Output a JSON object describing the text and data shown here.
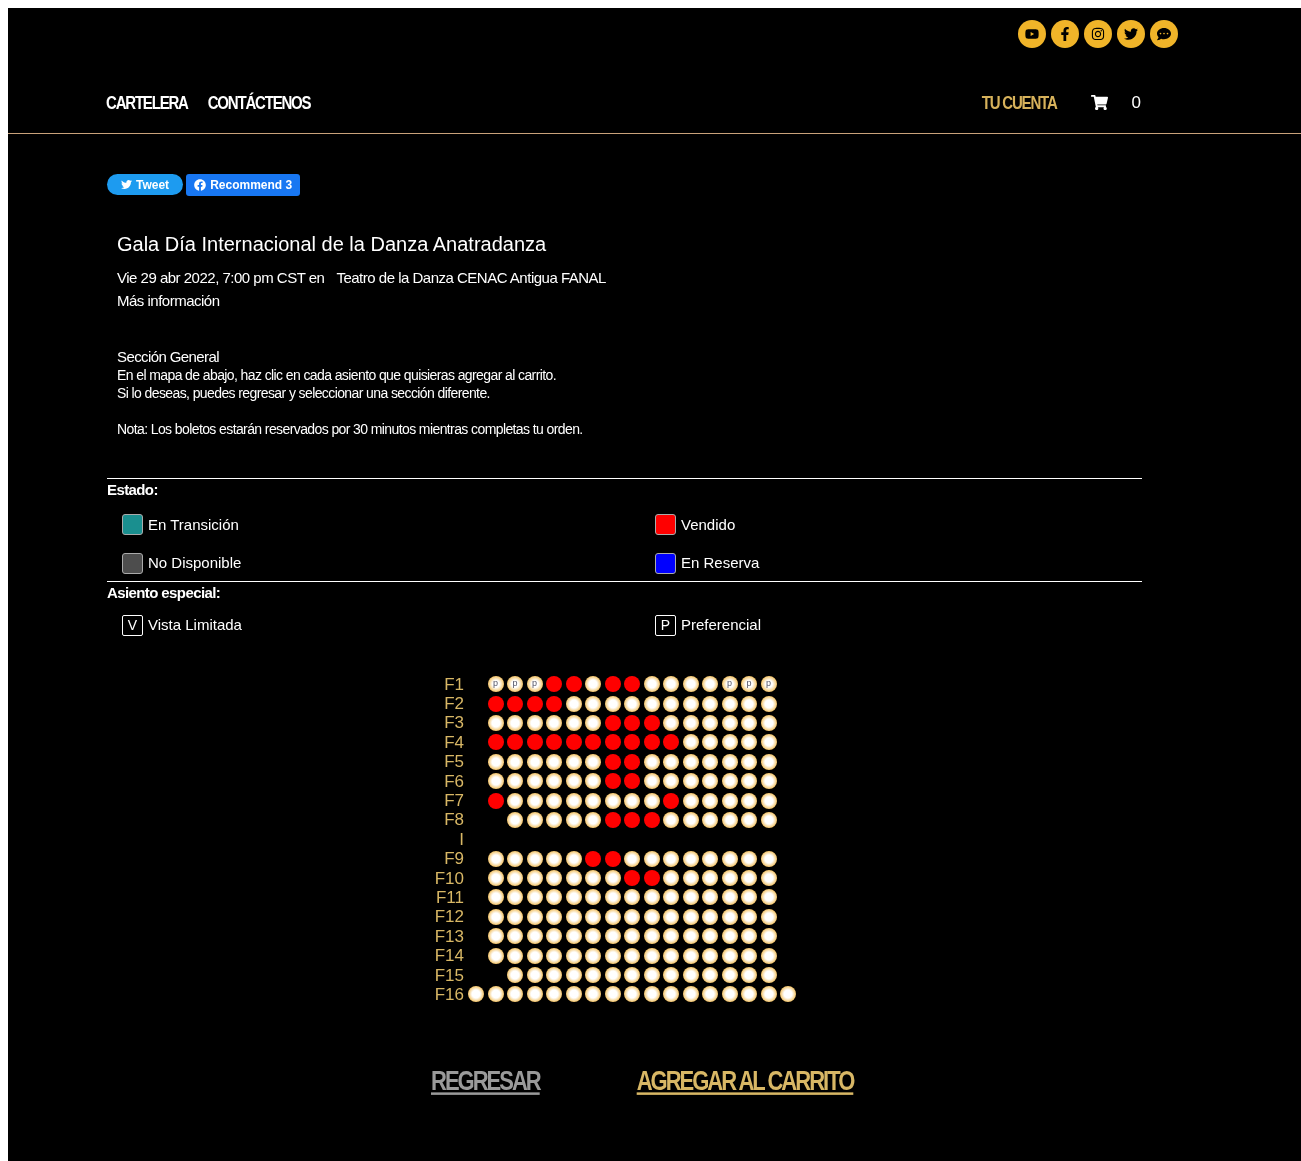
{
  "header": {
    "nav": [
      {
        "label": "CARTELERA"
      },
      {
        "label": "CONTÁCTENOS"
      }
    ],
    "account": "TU CUENTA",
    "cart_count": "0"
  },
  "share": {
    "tweet": "Tweet",
    "recommend": "Recommend 3"
  },
  "event": {
    "title": "Gala Día Internacional de la Danza Anatradanza",
    "date": "Vie 29 abr 2022, 7:00 pm CST en",
    "venue": "Teatro de la Danza CENAC Antigua FANAL",
    "more": "Más información"
  },
  "instructions": [
    "Sección General",
    "En el mapa de abajo, haz clic en cada asiento que quisieras agregar al carrito.",
    "Si lo deseas, puedes regresar y seleccionar una sección diferente."
  ],
  "note": "Nota: Los boletos estarán reservados por 30 minutos mientras completas tu orden.",
  "status_legend": {
    "title": "Estado:",
    "items": [
      {
        "label": "En Transición",
        "color": "#1a8f8f"
      },
      {
        "label": "Vendido",
        "color": "#ff0000"
      },
      {
        "label": "No Disponible",
        "color": "#4d4d4d"
      },
      {
        "label": "En Reserva",
        "color": "#0000ff"
      }
    ]
  },
  "special_legend": {
    "title": "Asiento especial:",
    "items": [
      {
        "mark": "V",
        "label": "Vista Limitada"
      },
      {
        "mark": "P",
        "label": "Preferencial"
      }
    ]
  },
  "seat_map": {
    "rows": [
      {
        "label": "F1",
        "seats": [
          {
            "sold": false,
            "mark": "p"
          },
          {
            "sold": false,
            "mark": "p"
          },
          {
            "sold": false,
            "mark": "p"
          },
          {
            "sold": true
          },
          {
            "sold": true
          },
          {
            "sold": false
          },
          {
            "sold": true
          },
          {
            "sold": true
          },
          {
            "sold": false
          },
          {
            "sold": false
          },
          {
            "sold": false
          },
          {
            "sold": false
          },
          {
            "sold": false,
            "mark": "p"
          },
          {
            "sold": false,
            "mark": "p"
          },
          {
            "sold": false,
            "mark": "p"
          }
        ]
      },
      {
        "label": "F2",
        "seats": [
          {
            "sold": true
          },
          {
            "sold": true
          },
          {
            "sold": true
          },
          {
            "sold": true
          },
          {
            "sold": false
          },
          {
            "sold": false
          },
          {
            "sold": false
          },
          {
            "sold": false
          },
          {
            "sold": false
          },
          {
            "sold": false
          },
          {
            "sold": false
          },
          {
            "sold": false
          },
          {
            "sold": false
          },
          {
            "sold": false
          },
          {
            "sold": false
          }
        ]
      },
      {
        "label": "F3",
        "seats": [
          {
            "sold": false
          },
          {
            "sold": false
          },
          {
            "sold": false
          },
          {
            "sold": false
          },
          {
            "sold": false
          },
          {
            "sold": false
          },
          {
            "sold": true
          },
          {
            "sold": true
          },
          {
            "sold": true
          },
          {
            "sold": false
          },
          {
            "sold": false
          },
          {
            "sold": false
          },
          {
            "sold": false
          },
          {
            "sold": false
          },
          {
            "sold": false
          }
        ]
      },
      {
        "label": "F4",
        "seats": [
          {
            "sold": true
          },
          {
            "sold": true
          },
          {
            "sold": true
          },
          {
            "sold": true
          },
          {
            "sold": true
          },
          {
            "sold": true
          },
          {
            "sold": true
          },
          {
            "sold": true
          },
          {
            "sold": true
          },
          {
            "sold": true
          },
          {
            "sold": false
          },
          {
            "sold": false
          },
          {
            "sold": false
          },
          {
            "sold": false
          },
          {
            "sold": false
          }
        ]
      },
      {
        "label": "F5",
        "seats": [
          {
            "sold": false
          },
          {
            "sold": false
          },
          {
            "sold": false
          },
          {
            "sold": false
          },
          {
            "sold": false
          },
          {
            "sold": false
          },
          {
            "sold": true
          },
          {
            "sold": true
          },
          {
            "sold": false
          },
          {
            "sold": false
          },
          {
            "sold": false
          },
          {
            "sold": false
          },
          {
            "sold": false
          },
          {
            "sold": false
          },
          {
            "sold": false
          }
        ]
      },
      {
        "label": "F6",
        "seats": [
          {
            "sold": false
          },
          {
            "sold": false
          },
          {
            "sold": false
          },
          {
            "sold": false
          },
          {
            "sold": false
          },
          {
            "sold": false
          },
          {
            "sold": true
          },
          {
            "sold": true
          },
          {
            "sold": false
          },
          {
            "sold": false
          },
          {
            "sold": false
          },
          {
            "sold": false
          },
          {
            "sold": false
          },
          {
            "sold": false
          },
          {
            "sold": false
          }
        ]
      },
      {
        "label": "F7",
        "seats": [
          {
            "sold": true
          },
          {
            "sold": false
          },
          {
            "sold": false
          },
          {
            "sold": false
          },
          {
            "sold": false
          },
          {
            "sold": false
          },
          {
            "sold": false
          },
          {
            "sold": false
          },
          {
            "sold": false
          },
          {
            "sold": true
          },
          {
            "sold": false
          },
          {
            "sold": false
          },
          {
            "sold": false
          },
          {
            "sold": false
          },
          {
            "sold": false
          }
        ]
      },
      {
        "label": "F8",
        "seats": [
          {
            "sold": false
          },
          {
            "sold": false
          },
          {
            "sold": false
          },
          {
            "sold": false
          },
          {
            "sold": false
          },
          {
            "sold": true
          },
          {
            "sold": true
          },
          {
            "sold": true
          },
          {
            "sold": false
          },
          {
            "sold": false
          },
          {
            "sold": false
          },
          {
            "sold": false
          },
          {
            "sold": false
          },
          {
            "sold": false
          }
        ]
      },
      {
        "label": "I"
      },
      {
        "label": "F9",
        "seats": [
          {
            "sold": false
          },
          {
            "sold": false
          },
          {
            "sold": false
          },
          {
            "sold": false
          },
          {
            "sold": false
          },
          {
            "sold": true
          },
          {
            "sold": true
          },
          {
            "sold": false
          },
          {
            "sold": false
          },
          {
            "sold": false
          },
          {
            "sold": false
          },
          {
            "sold": false
          },
          {
            "sold": false
          },
          {
            "sold": false
          },
          {
            "sold": false
          }
        ]
      },
      {
        "label": "F10",
        "seats": [
          {
            "sold": false
          },
          {
            "sold": false
          },
          {
            "sold": false
          },
          {
            "sold": false
          },
          {
            "sold": false
          },
          {
            "sold": false
          },
          {
            "sold": false
          },
          {
            "sold": true
          },
          {
            "sold": true
          },
          {
            "sold": false
          },
          {
            "sold": false
          },
          {
            "sold": false
          },
          {
            "sold": false
          },
          {
            "sold": false
          },
          {
            "sold": false
          }
        ]
      },
      {
        "label": "F11",
        "seats": [
          {
            "sold": false
          },
          {
            "sold": false
          },
          {
            "sold": false
          },
          {
            "sold": false
          },
          {
            "sold": false
          },
          {
            "sold": false
          },
          {
            "sold": false
          },
          {
            "sold": false
          },
          {
            "sold": false
          },
          {
            "sold": false
          },
          {
            "sold": false
          },
          {
            "sold": false
          },
          {
            "sold": false
          },
          {
            "sold": false
          },
          {
            "sold": false
          }
        ]
      },
      {
        "label": "F12",
        "seats": [
          {
            "sold": false
          },
          {
            "sold": false
          },
          {
            "sold": false
          },
          {
            "sold": false
          },
          {
            "sold": false
          },
          {
            "sold": false
          },
          {
            "sold": false
          },
          {
            "sold": false
          },
          {
            "sold": false
          },
          {
            "sold": false
          },
          {
            "sold": false
          },
          {
            "sold": false
          },
          {
            "sold": false
          },
          {
            "sold": false
          },
          {
            "sold": false
          }
        ]
      },
      {
        "label": "F13",
        "seats": [
          {
            "sold": false
          },
          {
            "sold": false
          },
          {
            "sold": false
          },
          {
            "sold": false
          },
          {
            "sold": false
          },
          {
            "sold": false
          },
          {
            "sold": false
          },
          {
            "sold": false
          },
          {
            "sold": false
          },
          {
            "sold": false
          },
          {
            "sold": false
          },
          {
            "sold": false
          },
          {
            "sold": false
          },
          {
            "sold": false
          },
          {
            "sold": false
          }
        ]
      },
      {
        "label": "F14",
        "seats": [
          {
            "sold": false
          },
          {
            "sold": false
          },
          {
            "sold": false
          },
          {
            "sold": false
          },
          {
            "sold": false
          },
          {
            "sold": false
          },
          {
            "sold": false
          },
          {
            "sold": false
          },
          {
            "sold": false
          },
          {
            "sold": false
          },
          {
            "sold": false
          },
          {
            "sold": false
          },
          {
            "sold": false
          },
          {
            "sold": false
          },
          {
            "sold": false
          }
        ]
      },
      {
        "label": "F15",
        "seats": [
          {
            "sold": false
          },
          {
            "sold": false
          },
          {
            "sold": false
          },
          {
            "sold": false
          },
          {
            "sold": false
          },
          {
            "sold": false
          },
          {
            "sold": false
          },
          {
            "sold": false
          },
          {
            "sold": false
          },
          {
            "sold": false
          },
          {
            "sold": false
          },
          {
            "sold": false
          },
          {
            "sold": false
          },
          {
            "sold": false
          }
        ]
      },
      {
        "label": "F16",
        "seats": [
          {
            "sold": false
          },
          {
            "sold": false
          },
          {
            "sold": false
          },
          {
            "sold": false
          },
          {
            "sold": false
          },
          {
            "sold": false
          },
          {
            "sold": false
          },
          {
            "sold": false
          },
          {
            "sold": false
          },
          {
            "sold": false
          },
          {
            "sold": false
          },
          {
            "sold": false
          },
          {
            "sold": false
          },
          {
            "sold": false
          },
          {
            "sold": false
          },
          {
            "sold": false
          },
          {
            "sold": false
          }
        ]
      }
    ]
  },
  "actions": {
    "back": "REGRESAR",
    "add": "AGREGAR AL CARRITO"
  }
}
